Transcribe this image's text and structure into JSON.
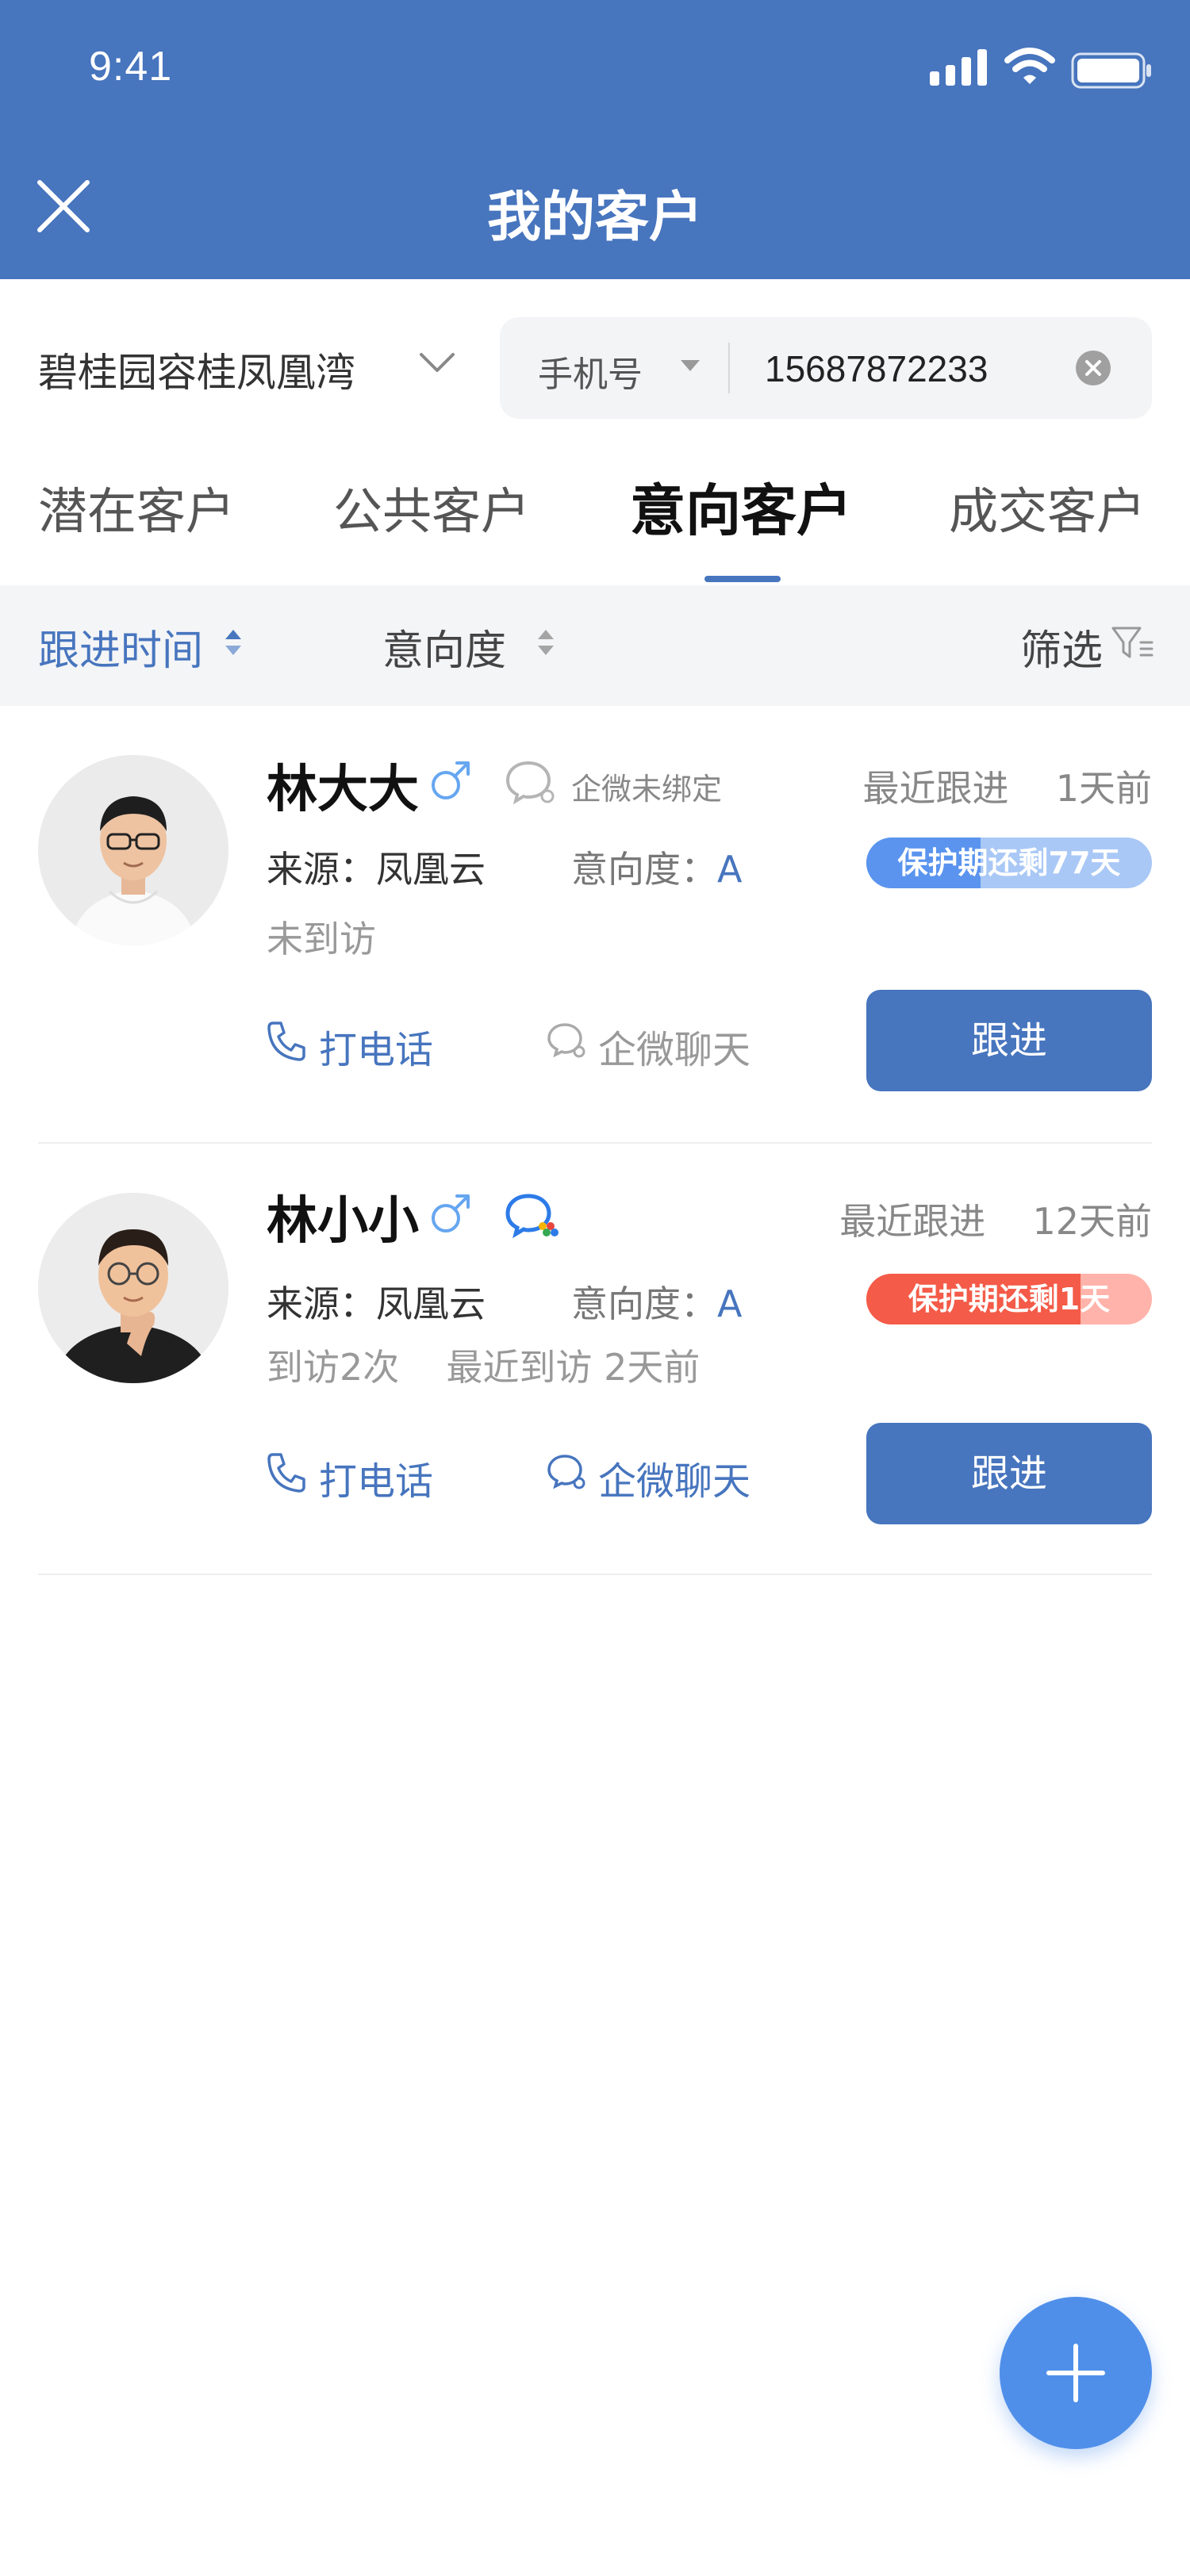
{
  "status_bar": {
    "time": "9:41"
  },
  "header": {
    "title": "我的客户",
    "close_icon": "close-icon",
    "background_color": "#4775BE"
  },
  "project": {
    "name": "碧桂园容桂凤凰湾"
  },
  "search": {
    "type_label": "手机号",
    "value": "15687872233"
  },
  "tabs": [
    {
      "label": "潜在客户",
      "active": false
    },
    {
      "label": "公共客户",
      "active": false
    },
    {
      "label": "意向客户",
      "active": true
    },
    {
      "label": "成交客户",
      "active": false
    }
  ],
  "sort_bar": {
    "time_label": "跟进时间",
    "intent_label": "意向度",
    "filter_label": "筛选"
  },
  "customers": [
    {
      "name": "林大大",
      "gender": "male",
      "wechat_status": "企微未绑定",
      "recent_label": "最近跟进",
      "recent_value": "1天前",
      "source_label": "来源：",
      "source": "凤凰云",
      "intent_label": "意向度：",
      "intent": "A",
      "protection_text": "保护期还剩77天",
      "protection_level": 0.4,
      "protection_color": "#5A94EE",
      "visit": "未到访",
      "call_label": "打电话",
      "chat_label": "企微聊天",
      "chat_enabled": false,
      "follow_label": "跟进"
    },
    {
      "name": "林小小",
      "gender": "male",
      "recent_label": "最近跟进",
      "recent_value": "12天前",
      "source_label": "来源：",
      "source": "凤凰云",
      "intent_label": "意向度：",
      "intent": "A",
      "protection_text": "保护期还剩1天",
      "protection_level": 0.75,
      "protection_color": "#F45B48",
      "visit_count": "到访2次",
      "visit_recent": "最近到访 2天前",
      "call_label": "打电话",
      "chat_label": "企微聊天",
      "chat_enabled": true,
      "follow_label": "跟进"
    }
  ],
  "fab": {
    "icon": "plus-icon",
    "color": "#4F8FEA"
  }
}
